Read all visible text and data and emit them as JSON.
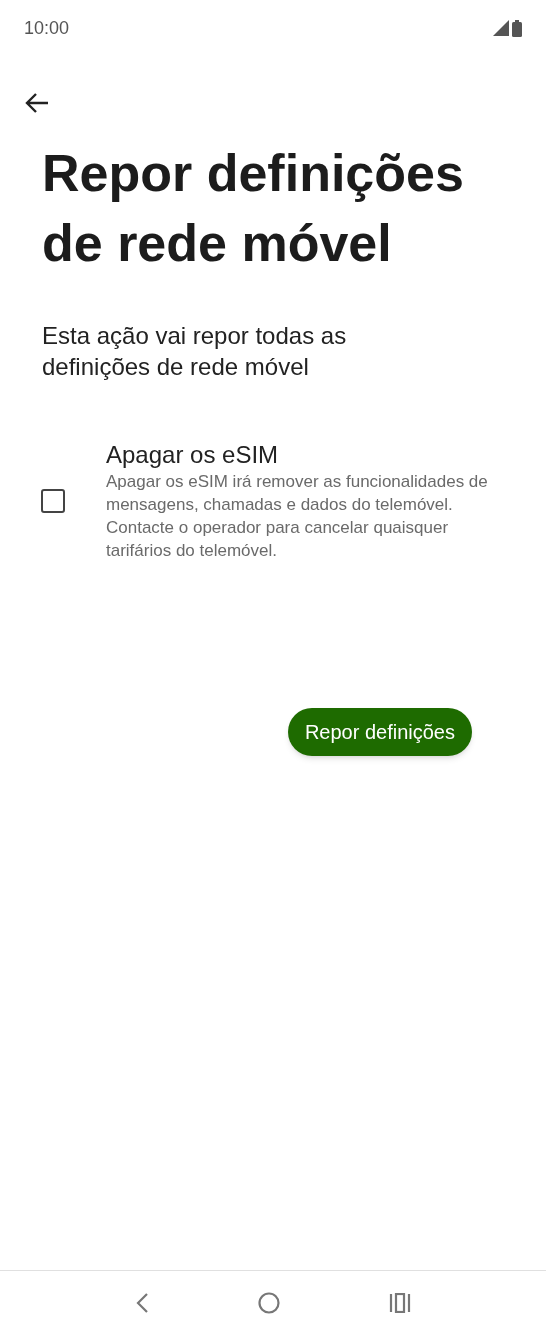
{
  "status_bar": {
    "time": "10:00"
  },
  "title": "Repor definições de rede móvel",
  "description": "Esta ação vai repor todas as definições de rede móvel",
  "option": {
    "label": "Apagar os eSIM",
    "detail": "Apagar os eSIM irá remover as funcionalidades de mensagens, chamadas e dados do telemóvel. Contacte o operador para cancelar quaisquer tarifários do telemóvel.",
    "checked": false
  },
  "button": {
    "label": "Repor definições"
  }
}
